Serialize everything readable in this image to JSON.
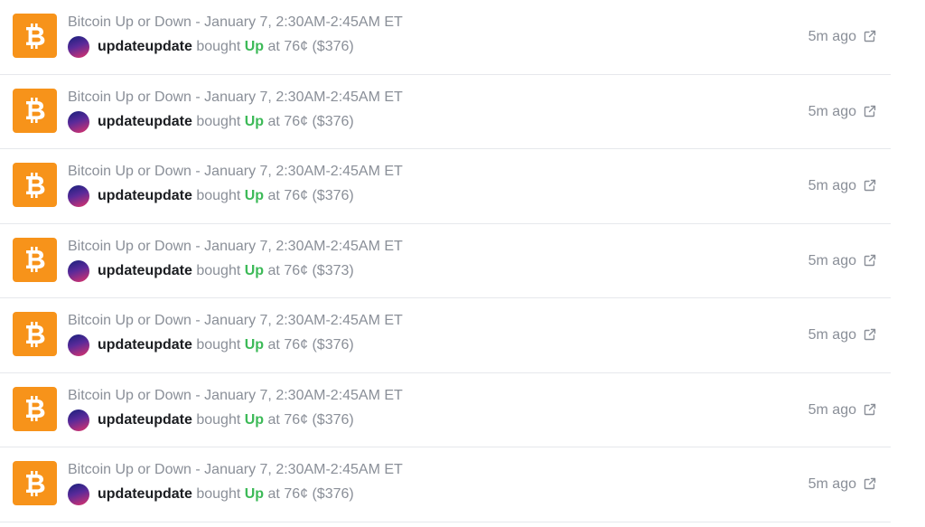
{
  "colors": {
    "bitcoin_orange": "#f7931a",
    "muted_text": "#8a8f98",
    "username_text": "#1b1d21",
    "outcome_up": "#3dba58",
    "divider": "#e6e8ec"
  },
  "icons": {
    "market": "bitcoin-icon",
    "link": "external-link-icon",
    "avatar": "gradient-avatar"
  },
  "activity": [
    {
      "market_title": "Bitcoin Up or Down - January 7, 2:30AM-2:45AM ET",
      "username": "updateupdate",
      "action": "bought",
      "outcome": "Up",
      "price": "76¢",
      "amount": "($376)",
      "time": "5m ago"
    },
    {
      "market_title": "Bitcoin Up or Down - January 7, 2:30AM-2:45AM ET",
      "username": "updateupdate",
      "action": "bought",
      "outcome": "Up",
      "price": "76¢",
      "amount": "($376)",
      "time": "5m ago"
    },
    {
      "market_title": "Bitcoin Up or Down - January 7, 2:30AM-2:45AM ET",
      "username": "updateupdate",
      "action": "bought",
      "outcome": "Up",
      "price": "76¢",
      "amount": "($376)",
      "time": "5m ago"
    },
    {
      "market_title": "Bitcoin Up or Down - January 7, 2:30AM-2:45AM ET",
      "username": "updateupdate",
      "action": "bought",
      "outcome": "Up",
      "price": "76¢",
      "amount": "($373)",
      "time": "5m ago"
    },
    {
      "market_title": "Bitcoin Up or Down - January 7, 2:30AM-2:45AM ET",
      "username": "updateupdate",
      "action": "bought",
      "outcome": "Up",
      "price": "76¢",
      "amount": "($376)",
      "time": "5m ago"
    },
    {
      "market_title": "Bitcoin Up or Down - January 7, 2:30AM-2:45AM ET",
      "username": "updateupdate",
      "action": "bought",
      "outcome": "Up",
      "price": "76¢",
      "amount": "($376)",
      "time": "5m ago"
    },
    {
      "market_title": "Bitcoin Up or Down - January 7, 2:30AM-2:45AM ET",
      "username": "updateupdate",
      "action": "bought",
      "outcome": "Up",
      "price": "76¢",
      "amount": "($376)",
      "time": "5m ago"
    }
  ],
  "connector_at": "at"
}
